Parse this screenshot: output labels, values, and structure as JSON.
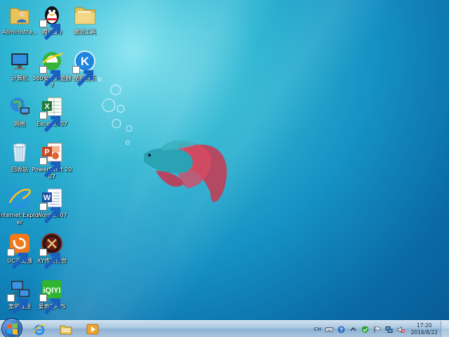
{
  "desktop_icons": [
    {
      "label": "Administra...",
      "icon": "user-folder-icon",
      "shortcut": false
    },
    {
      "label": "腾讯QQ",
      "icon": "qq-penguin-icon",
      "shortcut": true
    },
    {
      "label": "激活工具",
      "icon": "folder-icon",
      "shortcut": false
    },
    {
      "label": "计算机",
      "icon": "computer-icon",
      "shortcut": false
    },
    {
      "label": "360安全浏览器7",
      "icon": "360-browser-icon",
      "shortcut": true
    },
    {
      "label": "酷狗音乐",
      "icon": "kugou-music-icon",
      "shortcut": true
    },
    {
      "label": "网络",
      "icon": "network-globe-icon",
      "shortcut": false
    },
    {
      "label": "Excel 2007",
      "icon": "excel-icon",
      "shortcut": true
    },
    {
      "label": "回收站",
      "icon": "recycle-bin-icon",
      "shortcut": false
    },
    {
      "label": "PowerPoint 2007",
      "icon": "powerpoint-icon",
      "shortcut": true
    },
    {
      "label": "Internet Explorer",
      "icon": "internet-explorer-icon",
      "shortcut": false
    },
    {
      "label": "Word 2007",
      "icon": "word-icon",
      "shortcut": true
    },
    {
      "label": "UC浏览器",
      "icon": "uc-browser-icon",
      "shortcut": true
    },
    {
      "label": "XY传奇盛世",
      "icon": "xy-game-icon",
      "shortcut": true
    },
    {
      "label": "宽带连接",
      "icon": "broadband-connection-icon",
      "shortcut": true
    },
    {
      "label": "爱奇艺PPS",
      "icon": "iqiyi-icon",
      "shortcut": true
    }
  ],
  "taskbar": {
    "start_icon": "windows-start-icon",
    "pinned": [
      {
        "name": "internet-explorer",
        "icon": "ie-icon"
      },
      {
        "name": "windows-explorer",
        "icon": "explorer-folder-icon"
      },
      {
        "name": "media-player",
        "icon": "media-player-icon"
      }
    ],
    "tray": {
      "language": "CH",
      "time": "17:20",
      "date": "2016/8/22"
    }
  },
  "colors": {
    "wallpaper_light": "#86e4ef",
    "wallpaper_dark": "#085a93",
    "taskbar": "#a9c6e0"
  }
}
